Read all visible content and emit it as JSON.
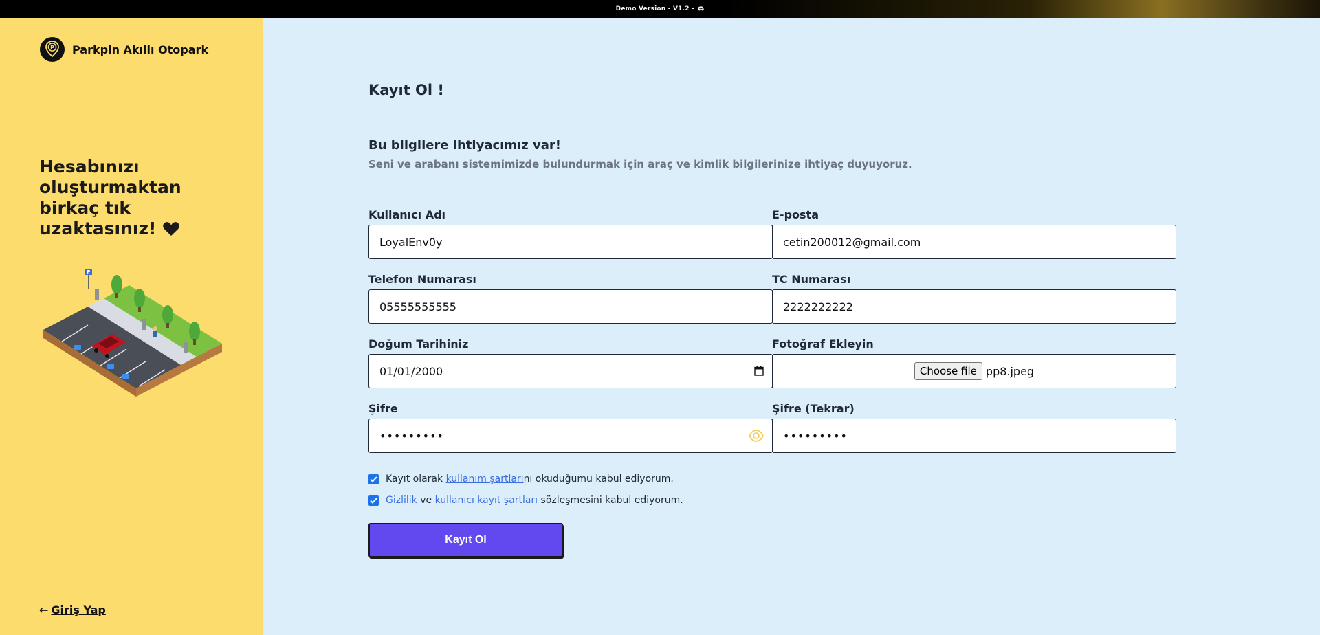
{
  "topbar": {
    "text": "Demo Version - V1.2 -"
  },
  "brand": {
    "name": "Parkpin Akıllı Otopark"
  },
  "sidebar": {
    "hero_text": "Hesabınızı oluşturmaktan birkaç tık uzaktasınız!",
    "login_arrow": "←",
    "login_label": "Giriş Yap"
  },
  "form": {
    "title": "Kayıt Ol !",
    "heading": "Bu bilgilere ihtiyacımız var!",
    "subheading": "Seni ve arabanı sistemimizde bulundurmak için araç ve kimlik bilgilerinize ihtiyaç duyuyoruz.",
    "username": {
      "label": "Kullanıcı Adı",
      "value": "LoyalEnv0y"
    },
    "email": {
      "label": "E-posta",
      "value": "cetin200012@gmail.com"
    },
    "phone": {
      "label": "Telefon Numarası",
      "value": "05555555555"
    },
    "tc": {
      "label": "TC Numarası",
      "value": "2222222222"
    },
    "birthdate": {
      "label": "Doğum Tarihiniz",
      "value": "01/01/2000"
    },
    "photo": {
      "label": "Fotoğraf Ekleyin",
      "button": "Choose file",
      "file_name": "pp8.jpeg"
    },
    "password": {
      "label": "Şifre",
      "value": "•••••••••"
    },
    "password_repeat": {
      "label": "Şifre (Tekrar)",
      "value": "•••••••••"
    },
    "terms1": {
      "before": "Kayıt olarak ",
      "link": "kullanım şartları",
      "after": "nı okuduğumu kabul ediyorum.",
      "checked": true
    },
    "terms2": {
      "link1": "Gizlilik",
      "middle": " ve ",
      "link2": "kullanıcı kayıt şartları",
      "after": " sözleşmesini kabul ediyorum.",
      "checked": true
    },
    "submit": "Kayıt Ol"
  },
  "colors": {
    "sidebar_bg": "#fddc6e",
    "main_bg": "#ddeefb",
    "accent": "#6248ef",
    "link": "#3b6fe0",
    "checkbox": "#1a73e8"
  }
}
